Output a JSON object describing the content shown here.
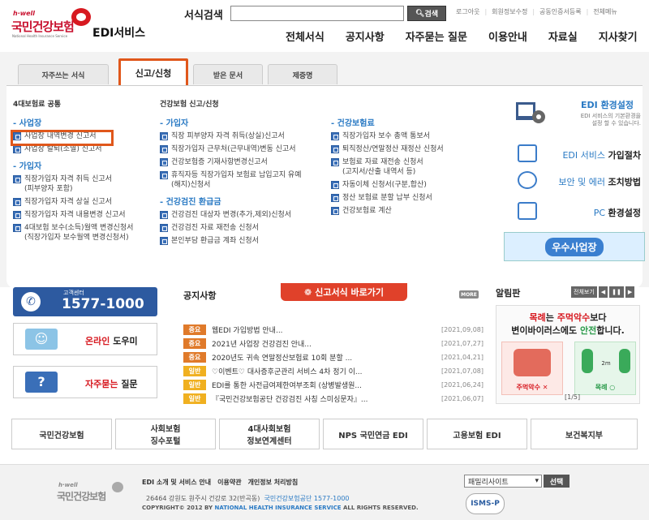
{
  "header": {
    "logo_hwell": "h·well",
    "logo_name": "국민건강보험",
    "logo_en": "National Health Insurance Service",
    "service_name": "EDI서비스",
    "search_label": "서식검색",
    "search_button": "검색",
    "top_links": [
      "로그아웃",
      "회원정보수정",
      "공동인증서등록",
      "전체메뉴"
    ],
    "gnb": [
      "전체서식",
      "공지사항",
      "자주묻는 질문",
      "이용안내",
      "자료실",
      "지사찾기"
    ]
  },
  "tabs": [
    "자주쓰는 서식",
    "신고/신청",
    "받은 문서",
    "제증명"
  ],
  "panel": {
    "col1_title": "4대보험료 공통",
    "col1": [
      {
        "section": "사업장",
        "items": [
          "사업장 내역변경 신고서",
          "사업장 탈퇴(소멸) 신고서"
        ]
      },
      {
        "section": "가입자",
        "items": [
          "직장가입자 자격 취득 신고서\n(피부양자 포함)",
          "직장가입자 자격 상실 신고서",
          "직장가입자 자격 내용변경 신고서",
          "4대보험 보수(소득)월액 변경신청서\n(직장가입자 보수월액 변경신청서)"
        ]
      }
    ],
    "col2_title": "건강보험 신고/신청",
    "col2": [
      {
        "section": "가입자",
        "items": [
          "직장 피부양자 자격 취득(상실)신고서",
          "직장가입자 근무처(근무내역)변동 신고서",
          "건강보험증 기재사항변경신고서",
          "휴직자등 직장가입자 보험료 납입고지 유예\n(해지)신청서"
        ]
      },
      {
        "section": "건강검진 환급금",
        "items": [
          "건강검진 대상자 변경(추가,제외)신청서",
          "건강검진 자료 재전송 신청서",
          "본인부담 환급금 계좌 신청서"
        ]
      }
    ],
    "col3": [
      {
        "section": "건강보험료",
        "items": [
          "직장가입자 보수 총액 통보서",
          "퇴직정산/연말정산 재정산 신청서",
          "보험료 자료 재전송 신청서\n(고지서/산출 내역서 등)",
          "자동이체 신청서(구분,합산)",
          "정산 보험료 분할 납부 신청서",
          "건강보험료 계산"
        ]
      }
    ]
  },
  "right_menu": {
    "env_title": "EDI 환경설정",
    "env_desc": "EDI 서비스의 기본환경을\n설정 할 수 있습니다.",
    "items": [
      {
        "label_a": "EDI 서비스",
        "label_b": "가입절차",
        "icon": "monitor-icon"
      },
      {
        "label_a": "보안 및 에러",
        "label_b": "조치방법",
        "icon": "shield-x-icon"
      },
      {
        "label_a": "PC",
        "label_b": "환경설정",
        "icon": "pc-icon"
      }
    ],
    "banner": "우수사업장"
  },
  "customer_center": {
    "label": "고객센터",
    "phone": "1577-1000"
  },
  "quick_links": [
    {
      "a": "온라인",
      "b": " 도우미",
      "icon": "person-icon"
    },
    {
      "a": "자주묻는",
      "b": " 질문",
      "icon": "question-icon"
    }
  ],
  "notice": {
    "title": "공지사항",
    "shortcut": "신고서식 바로가기",
    "more": "MORE",
    "rows": [
      {
        "badge": "중요",
        "color": "#e07a2a",
        "text": "웹EDI 가입방법 안내...",
        "date": "[2021,09,08]"
      },
      {
        "badge": "중요",
        "color": "#e07a2a",
        "text": "2021년 사업장 건강검진 안내...",
        "date": "[2021,07,27]"
      },
      {
        "badge": "중요",
        "color": "#e07a2a",
        "text": "2020년도 귀속 연말정산보험료 10회 분할 ...",
        "date": "[2021,04,21]"
      },
      {
        "badge": "일반",
        "color": "#f0b020",
        "text": "♡이벤트♡ 대사증후군관리 서비스 4차 정기 이...",
        "date": "[2021,07,08]"
      },
      {
        "badge": "일반",
        "color": "#f0b020",
        "text": "EDI를 통한 사전급여제한여부조회 (상병발생원...",
        "date": "[2021,06,24]"
      },
      {
        "badge": "일반",
        "color": "#f0b020",
        "text": "『국민건강보험공단 건강검진 사칭 스미싱문자』...",
        "date": "[2021,06,07]"
      }
    ]
  },
  "alim": {
    "title": "알림판",
    "controls": [
      "전체보기",
      "◀",
      "❚❚",
      "▶"
    ],
    "line1_a": "목례",
    "line1_b": "는 ",
    "line1_c": "주먹악수",
    "line1_d": "보다",
    "line2_a": "변이바이러스에도 ",
    "line2_b": "안전",
    "line2_c": "합니다.",
    "left_caption": "주먹악수 ✕",
    "right_caption": "목례 ○",
    "distance": "2m",
    "pager": "[1/5]"
  },
  "banners": [
    "국민건강보험",
    "사회보험\n징수포털",
    "4대사회보험\n정보연계센터",
    "NPS 국민연금 EDI",
    "고용보험 EDI",
    "보건복지부"
  ],
  "footer": {
    "links": [
      "EDI 소개 및 서비스 안내",
      "이용약관",
      "개인정보 처리방침"
    ],
    "address": "26464 강원도 원주시 건강로 32(반곡동)",
    "address_b": "국민건강보험공단 1577-1000",
    "copy_a": "COPYRIGHT© 2012 BY ",
    "copy_b": "NATIONAL HEALTH INSURANCE SERVICE",
    "copy_c": " ALL RIGHTS RESERVED.",
    "family_site": "패밀리사이트",
    "select_btn": "선택",
    "isms": "ISMS-P"
  }
}
